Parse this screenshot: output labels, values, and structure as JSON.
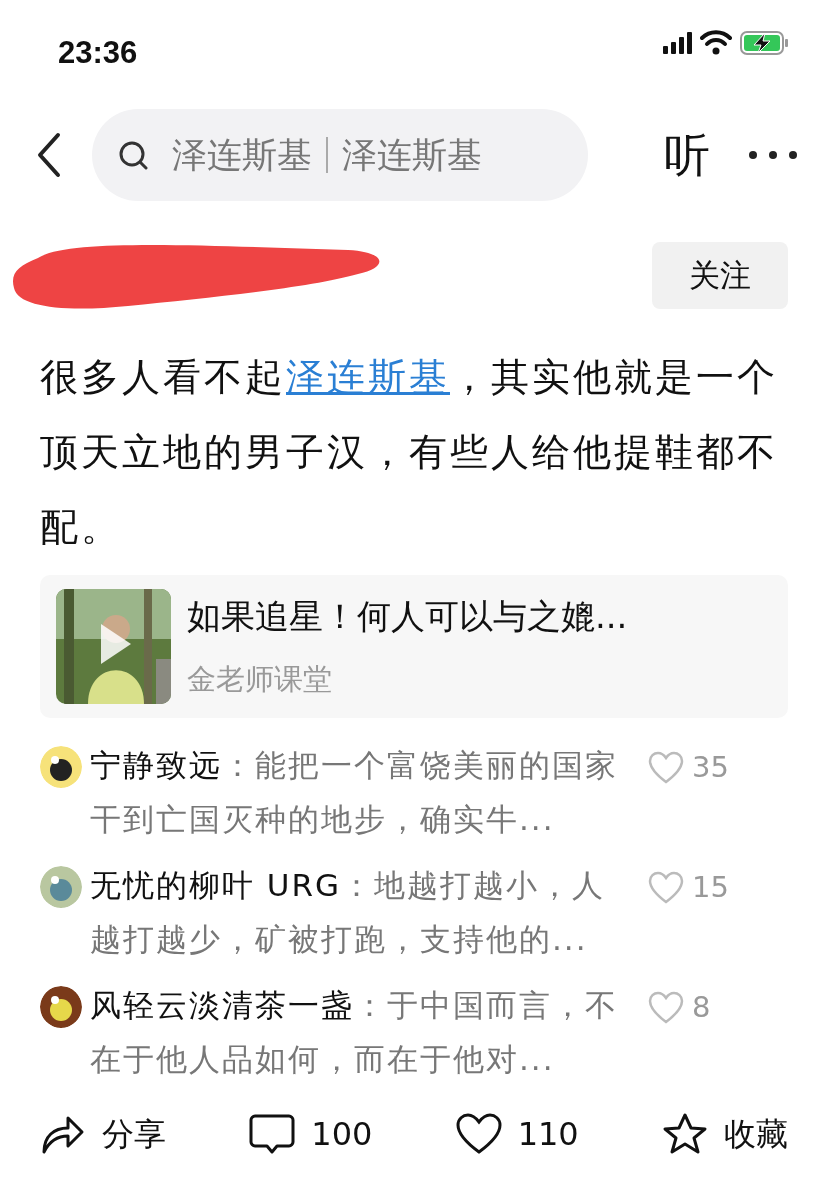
{
  "status_bar": {
    "time": "23:36",
    "charging": true
  },
  "header": {
    "search_terms": [
      "泽连斯基",
      "泽连斯基"
    ],
    "listen_label": "听"
  },
  "author": {
    "follow_label": "关注"
  },
  "post": {
    "segments": [
      {
        "kind": "text",
        "text": "很多人看不起"
      },
      {
        "kind": "link",
        "text": "泽连斯基"
      },
      {
        "kind": "text",
        "text": "，其实他就是一个顶天立地的男子汉，有些人给他提鞋都不配。"
      }
    ]
  },
  "video_card": {
    "title": "如果追星！何人可以与之媲...",
    "source": "金老师课堂"
  },
  "comments": [
    {
      "author": "宁静致远",
      "text": "：能把一个富饶美丽的国家干到亡国灭种的地步，确实牛...",
      "likes": "35"
    },
    {
      "author": "无忧的柳叶 URG",
      "text": "：地越打越小，人越打越少，矿被打跑，支持他的...",
      "likes": "15"
    },
    {
      "author": "风轻云淡清茶一盏",
      "text": "：于中国而言，不在于他人品如何，而在于他对...",
      "likes": "8"
    }
  ],
  "action_bar": [
    {
      "kind": "share",
      "label": "分享"
    },
    {
      "kind": "comment",
      "label": "100"
    },
    {
      "kind": "like",
      "label": "110"
    },
    {
      "kind": "favorite",
      "label": "收藏"
    }
  ]
}
